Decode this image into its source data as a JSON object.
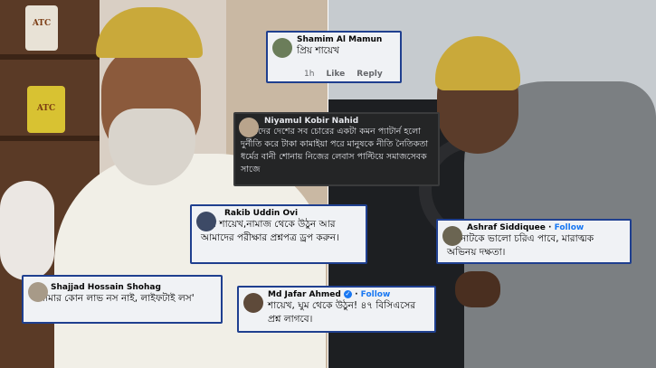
{
  "comments": [
    {
      "name": "Shamim Al Mamun",
      "text": "প্রিয় শায়েখ",
      "time": "1h",
      "like": "Like",
      "reply": "Reply"
    },
    {
      "name": "Niyamul Kobir Nahid",
      "text": "আমাদের দেশের সব চোরের একটা কমন প্যাটার্ন হলো দুর্নীতি করে টাকা কামাইয়া পরে মানুষকে নীতি নৈতিকতা ধর্মের বানী শোনায় নিজের লেবাস পাল্টিয়ে সমাজসেবক সাজে"
    },
    {
      "name": "Rakib Uddin Ovi",
      "text": "প্রিয় শায়েখ,নামাজ থেকে উঠুন আর আমাদের পরীক্ষার প্রশ্নপত্র ড্রপ করুন।"
    },
    {
      "name": "Ashraf Siddiquee",
      "follow": "Follow",
      "text": "মঞ্চনাটকে ভালো চরিএ পাবে, মারাত্মক অভিনয় দক্ষতা।"
    },
    {
      "name": "Shajjad Hossain Shohag",
      "text": "'আমার কোন লাভ নস নাই, লাইফটাই লস'"
    },
    {
      "name": "Md Jafar Ahmed",
      "follow": "Follow",
      "text": "শায়েখ, ঘুম থেকে উঠুন! ৪৭ বিসিএসের প্রশ্ন লাগবে।"
    }
  ],
  "decor": {
    "jar_label_1": "ATC",
    "jar_label_2": "ATC"
  },
  "colors": {
    "card_border": "#1f3f8f",
    "card_bg": "#f0f2f5",
    "dark_card_bg": "#242526",
    "follow": "#1877f2"
  }
}
